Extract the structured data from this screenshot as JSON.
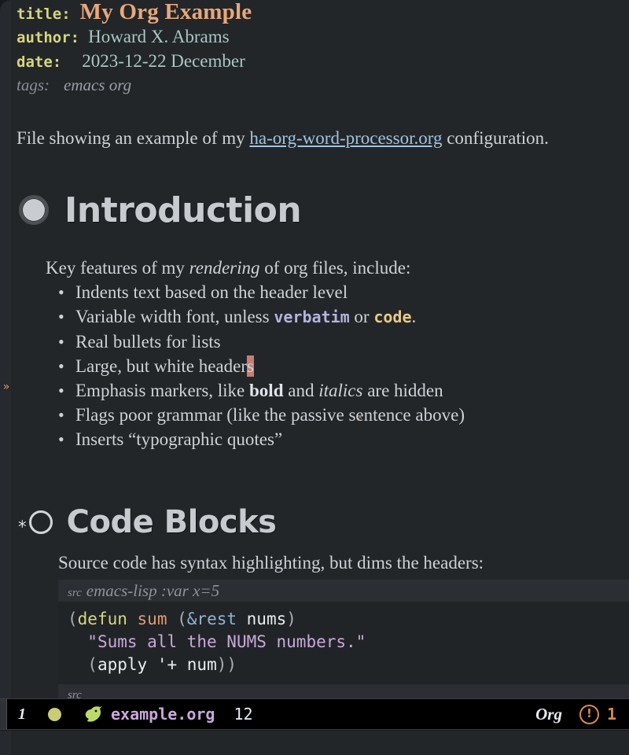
{
  "window": {
    "background": "#232629",
    "frame_background": "#17191c"
  },
  "document": {
    "keywords": {
      "title_label": "title:",
      "title_value": "My Org Example",
      "author_label": "author:",
      "author_value": "Howard X. Abrams",
      "date_label": "date:",
      "date_value": "2023-12-22 December",
      "tags_label": "tags:",
      "tags_value": "emacs org"
    },
    "intro": {
      "before_link": "File showing an example of my ",
      "link_text": "ha-org-word-processor.org",
      "after_link": " configuration."
    },
    "sections": [
      {
        "bullet": "filled-ring-bullet",
        "heading": "Introduction",
        "level": 1,
        "lead": {
          "before_italic": "Key features of my ",
          "italic": "rendering",
          "after_italic": " of org files, include:"
        },
        "items": [
          {
            "text": "Indents text based on the header level"
          },
          {
            "prefix": "Variable width font, unless ",
            "verbatim": "verbatim",
            "mid": " or ",
            "code": "code",
            "suffix": "."
          },
          {
            "text": "Real bullets for lists"
          },
          {
            "prefix": "Large, but white header",
            "cursor_char": "s",
            "suffix": ""
          },
          {
            "prefix": "Emphasis markers, like ",
            "bold": "bold",
            "mid": " and ",
            "italic": "italics",
            "suffix": " are hidden"
          },
          {
            "text": "Flags poor grammar (like the passive sentence above)"
          },
          {
            "text": "Inserts “typographic quotes”"
          }
        ]
      },
      {
        "bullet": "open-ring-bullet",
        "star": "*",
        "heading": "Code Blocks",
        "level": 2,
        "lead_plain": "Source code has syntax highlighting, but dims the headers:",
        "src_block": {
          "begin_keyword": "src",
          "begin_args": "emacs-lisp :var x=5",
          "end_keyword": "src",
          "lines": [
            {
              "tokens": [
                {
                  "t": "(",
                  "c": "paren"
                },
                {
                  "t": "defun",
                  "c": "keyword"
                },
                {
                  "t": " ",
                  "c": "plain"
                },
                {
                  "t": "sum",
                  "c": "fn"
                },
                {
                  "t": " ",
                  "c": "plain"
                },
                {
                  "t": "(",
                  "c": "paren"
                },
                {
                  "t": "&rest",
                  "c": "arg"
                },
                {
                  "t": " ",
                  "c": "plain"
                },
                {
                  "t": "nums",
                  "c": "var"
                },
                {
                  "t": ")",
                  "c": "paren"
                }
              ]
            },
            {
              "tokens": [
                {
                  "t": "  ",
                  "c": "plain"
                },
                {
                  "t": "\"Sums all the NUMS numbers.\"",
                  "c": "string"
                }
              ]
            },
            {
              "tokens": [
                {
                  "t": "  ",
                  "c": "plain"
                },
                {
                  "t": "(",
                  "c": "paren"
                },
                {
                  "t": "apply",
                  "c": "var"
                },
                {
                  "t": " ",
                  "c": "plain"
                },
                {
                  "t": "'+",
                  "c": "var"
                },
                {
                  "t": " ",
                  "c": "plain"
                },
                {
                  "t": "num",
                  "c": "var"
                },
                {
                  "t": "))",
                  "c": "paren"
                }
              ]
            }
          ]
        }
      }
    ]
  },
  "fringe": {
    "arrow_glyph": "»"
  },
  "modeline": {
    "window_number": "1",
    "status_dot_color": "#c9cc74",
    "icon_name": "gnu-icon",
    "buffer_name": "example.org",
    "column_number": "12",
    "major_mode": "Org",
    "warning_icon": "!",
    "warning_count": "1"
  }
}
